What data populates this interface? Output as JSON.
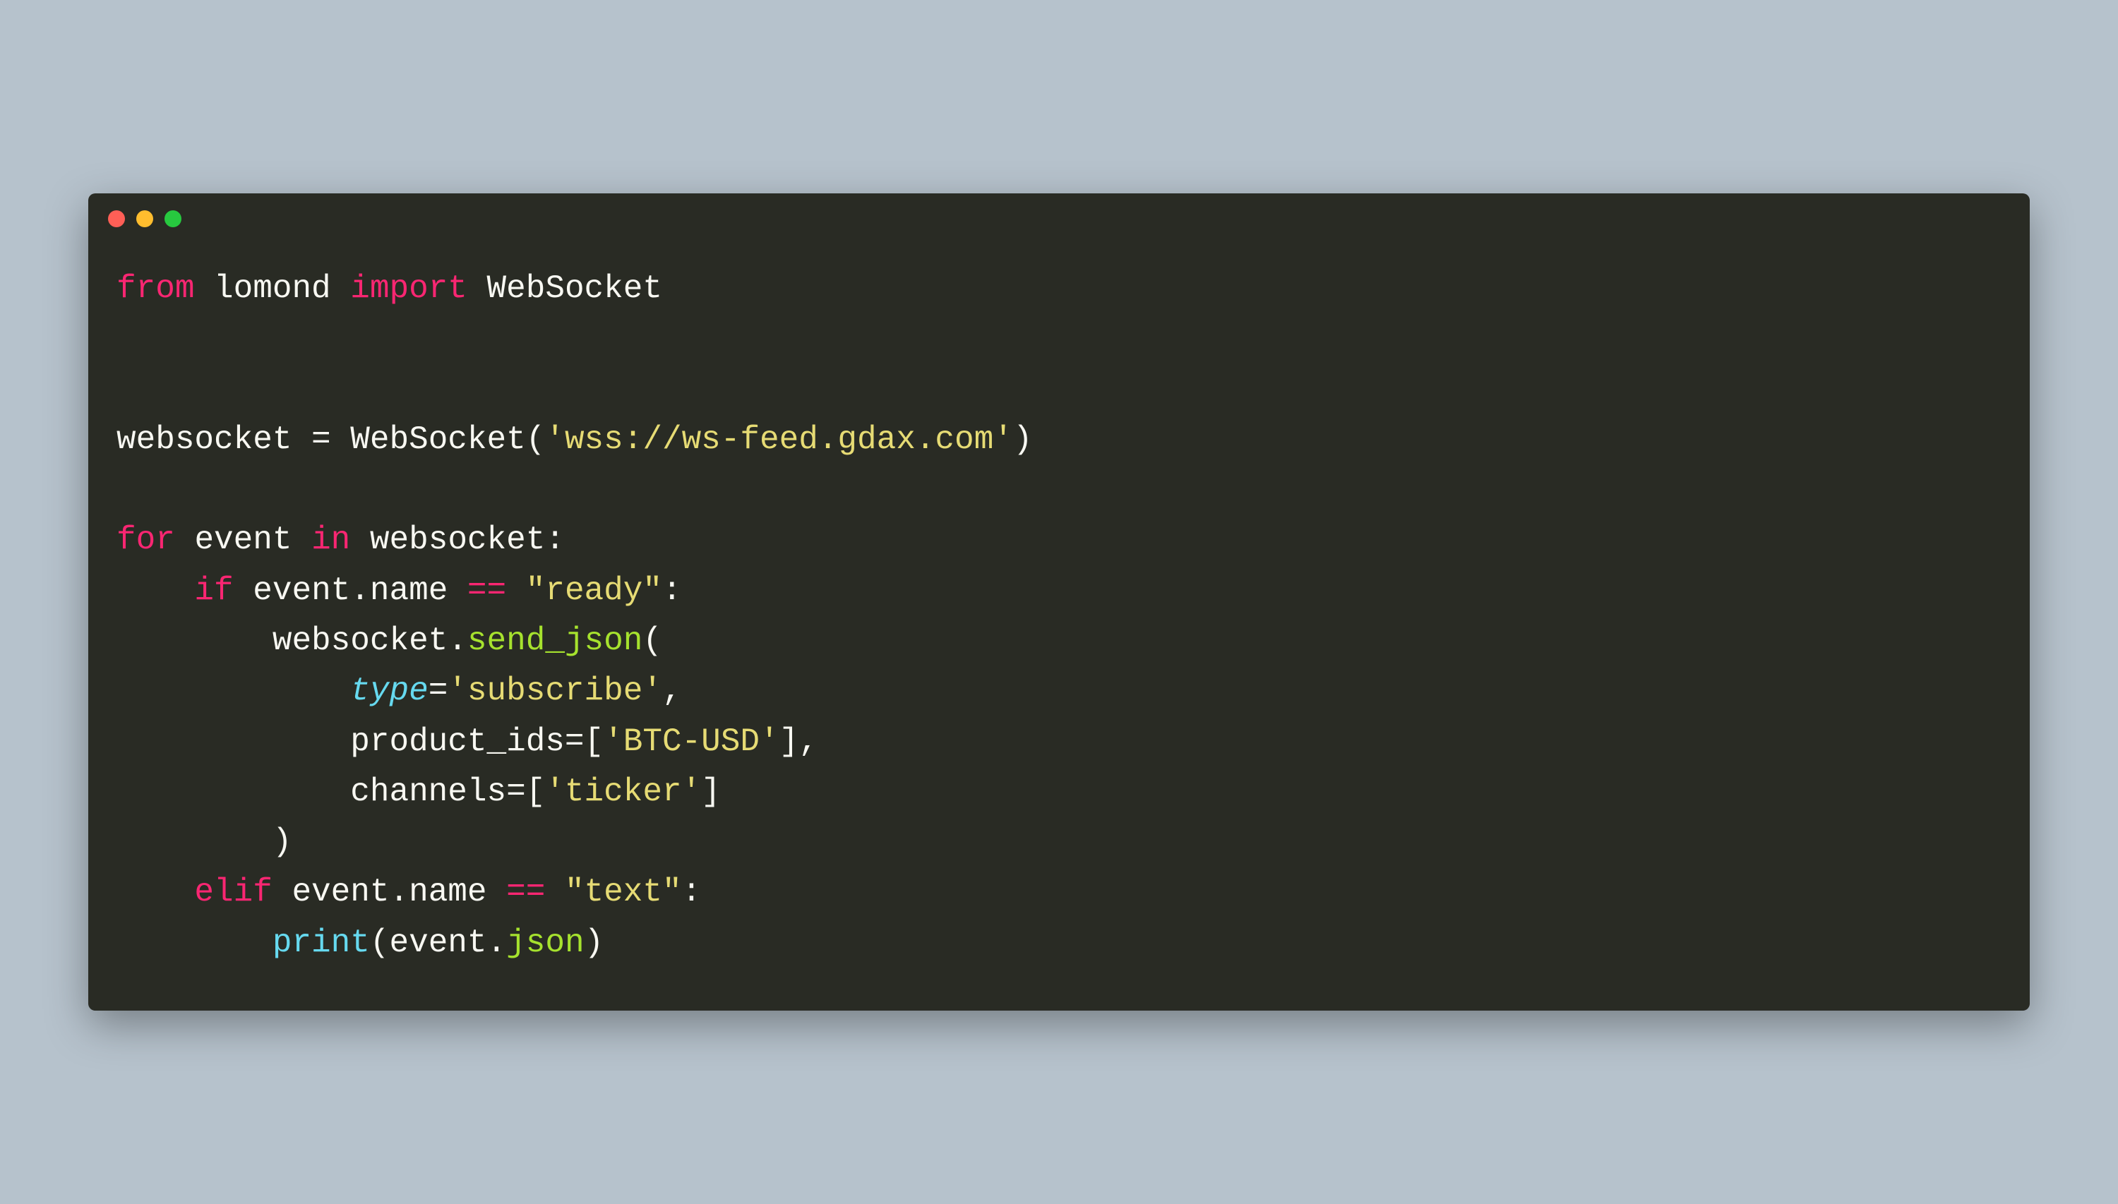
{
  "window": {
    "traffic_lights": [
      "red",
      "yellow",
      "green"
    ]
  },
  "code": {
    "line1": {
      "from": "from",
      "module": "lomond",
      "import": "import",
      "name": "WebSocket"
    },
    "line3": {
      "var": "websocket",
      "eq": " = ",
      "cls": "WebSocket",
      "open": "(",
      "str": "'wss://ws-feed.gdax.com'",
      "close": ")"
    },
    "line5": {
      "for": "for",
      "var": "event",
      "in": "in",
      "iter": "websocket",
      "colon": ":"
    },
    "line6": {
      "indent": "    ",
      "if": "if",
      "obj": "event",
      "dot": ".",
      "attr": "name",
      "op": " == ",
      "str": "\"ready\"",
      "colon": ":"
    },
    "line7": {
      "indent": "        ",
      "obj": "websocket",
      "dot": ".",
      "method": "send_json",
      "open": "("
    },
    "line8": {
      "indent": "            ",
      "param": "type",
      "eq": "=",
      "str": "'subscribe'",
      "comma": ","
    },
    "line9": {
      "indent": "            ",
      "param": "product_ids",
      "eq": "=[",
      "str": "'BTC-USD'",
      "close": "],"
    },
    "line10": {
      "indent": "            ",
      "param": "channels",
      "eq": "=[",
      "str": "'ticker'",
      "close": "]"
    },
    "line11": {
      "indent": "        ",
      "close": ")"
    },
    "line12": {
      "indent": "    ",
      "elif": "elif",
      "obj": "event",
      "dot": ".",
      "attr": "name",
      "op": " == ",
      "str": "\"text\"",
      "colon": ":"
    },
    "line13": {
      "indent": "        ",
      "func": "print",
      "open": "(",
      "obj": "event",
      "dot": ".",
      "attr": "json",
      "close": ")"
    }
  }
}
